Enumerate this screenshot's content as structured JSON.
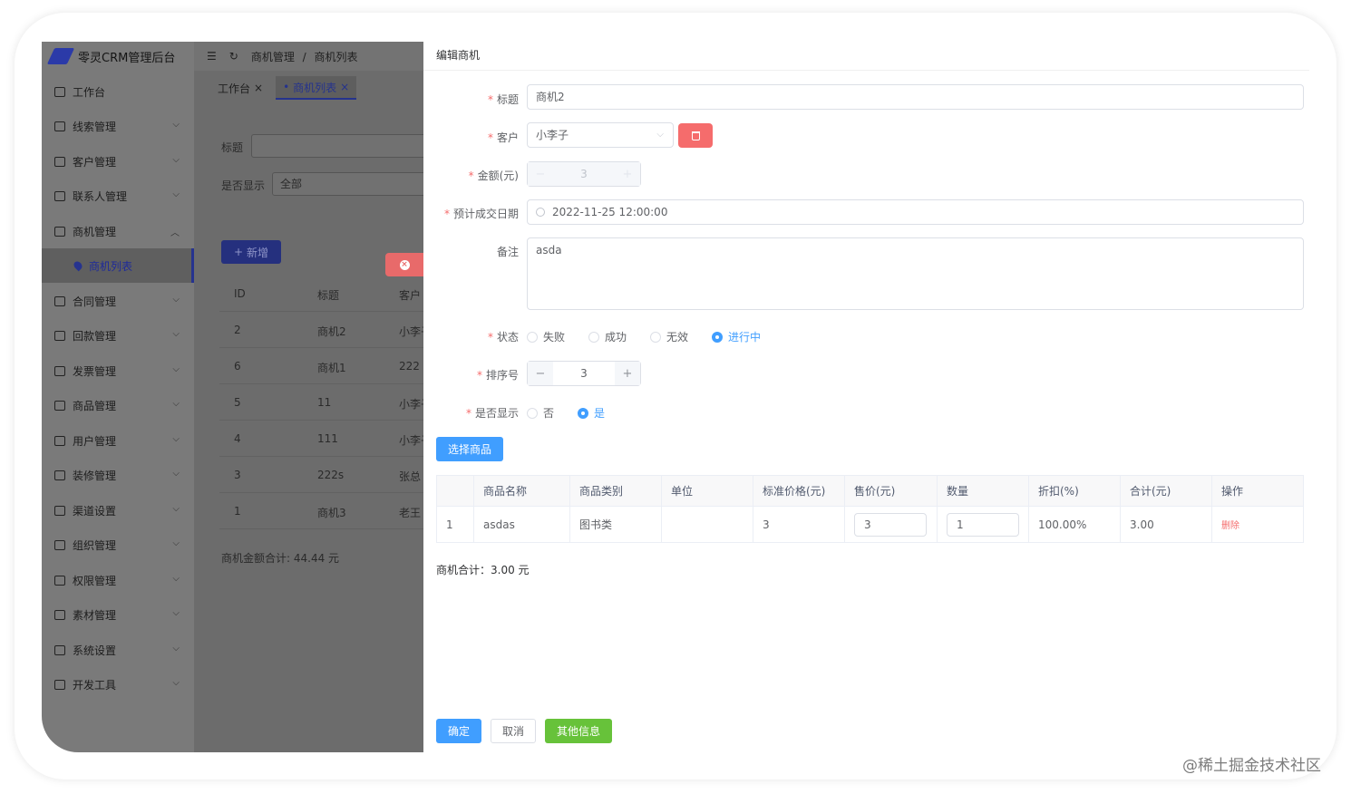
{
  "app": {
    "title": "零灵CRM管理后台"
  },
  "sidebar": {
    "items": [
      {
        "label": "工作台",
        "icon": "monitor-icon"
      },
      {
        "label": "线索管理",
        "icon": "clue-icon"
      },
      {
        "label": "客户管理",
        "icon": "user-icon"
      },
      {
        "label": "联系人管理",
        "icon": "contact-icon"
      },
      {
        "label": "商机管理",
        "icon": "send-icon",
        "expanded": true
      },
      {
        "label": "商机列表",
        "icon": "location-icon",
        "active": true
      },
      {
        "label": "合同管理",
        "icon": "bag-icon"
      },
      {
        "label": "回款管理",
        "icon": "money-icon"
      },
      {
        "label": "发票管理",
        "icon": "invoice-icon"
      },
      {
        "label": "商品管理",
        "icon": "shop-icon"
      },
      {
        "label": "用户管理",
        "icon": "user-icon"
      },
      {
        "label": "装修管理",
        "icon": "decorate-icon"
      },
      {
        "label": "渠道设置",
        "icon": "mail-icon"
      },
      {
        "label": "组织管理",
        "icon": "org-icon"
      },
      {
        "label": "权限管理",
        "icon": "lock-icon"
      },
      {
        "label": "素材管理",
        "icon": "picture-icon"
      },
      {
        "label": "系统设置",
        "icon": "gear-icon"
      },
      {
        "label": "开发工具",
        "icon": "pen-icon"
      }
    ]
  },
  "breadcrumb": {
    "parent": "商机管理",
    "sep": "/",
    "current": "商机列表"
  },
  "tabs": [
    {
      "label": "工作台"
    },
    {
      "label": "商机列表",
      "active": true
    }
  ],
  "filters": {
    "title_label": "标题",
    "show_label": "是否显示",
    "show_value": "全部"
  },
  "list": {
    "add_label": "新增",
    "columns": [
      "ID",
      "标题",
      "客户"
    ],
    "rows": [
      [
        "2",
        "商机2",
        "小李子"
      ],
      [
        "6",
        "商机1",
        "222"
      ],
      [
        "5",
        "11",
        "小李子"
      ],
      [
        "4",
        "111",
        "小李子"
      ],
      [
        "3",
        "222s",
        "张总"
      ],
      [
        "1",
        "商机3",
        "老王"
      ]
    ],
    "total_text": "商机金额合计: 44.44 元"
  },
  "drawer": {
    "title": "编辑商机",
    "fields": {
      "title_label": "标题",
      "title_value": "商机2",
      "customer_label": "客户",
      "customer_value": "小李子",
      "amount_label": "金额(元)",
      "amount_value": "3",
      "date_label": "预计成交日期",
      "date_value": "2022-11-25 12:00:00",
      "note_label": "备注",
      "note_value": "asda",
      "status_label": "状态",
      "status_options": [
        "失败",
        "成功",
        "无效",
        "进行中"
      ],
      "status_selected": "进行中",
      "sort_label": "排序号",
      "sort_value": "3",
      "show_label": "是否显示",
      "show_options": [
        "否",
        "是"
      ],
      "show_selected": "是"
    },
    "pick_goods_label": "选择商品",
    "goods_table": {
      "columns": [
        "",
        "商品名称",
        "商品类别",
        "单位",
        "标准价格(元)",
        "售价(元)",
        "数量",
        "折扣(%)",
        "合计(元)",
        "操作"
      ],
      "rows": [
        {
          "index": "1",
          "name": "asdas",
          "category": "图书类",
          "unit": "",
          "std_price": "3",
          "price": "3",
          "qty": "1",
          "discount": "100.00%",
          "total": "3.00",
          "action": "删除"
        }
      ]
    },
    "sum_text": "商机合计：3.00 元",
    "buttons": {
      "confirm": "确定",
      "cancel": "取消",
      "other": "其他信息"
    }
  },
  "watermark": "@稀土掘金技术社区",
  "colors": {
    "primary": "#409eff",
    "danger": "#f56c6c",
    "success": "#67c23a",
    "overlay": "#6c6c6c"
  }
}
